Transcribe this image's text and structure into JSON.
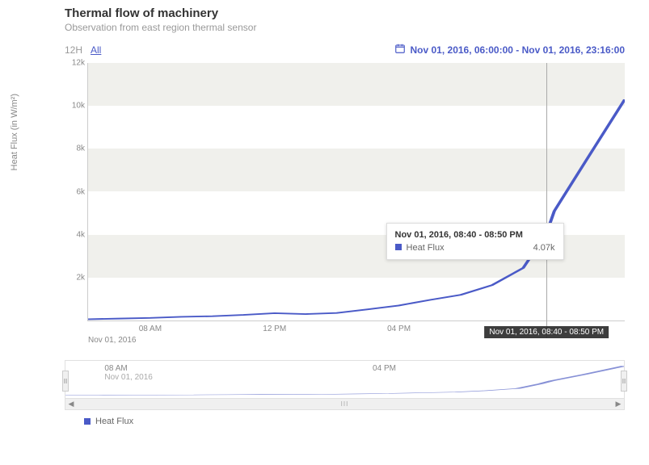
{
  "title": "Thermal flow of machinery",
  "subtitle": "Observation from east region thermal sensor",
  "range_buttons": {
    "h12": "12H",
    "all": "All"
  },
  "date_range": "Nov 01, 2016, 06:00:00 - Nov 01, 2016, 23:16:00",
  "yaxis_label": "Heat Flux (in W/m²)",
  "y_ticks": [
    "2k",
    "4k",
    "6k",
    "8k",
    "10k",
    "12k"
  ],
  "x_ticks": [
    "08 AM",
    "12 PM",
    "04 PM"
  ],
  "x_subtitle": "Nov 01, 2016",
  "cursor": {
    "time_label": "Nov 01, 2016, 08:40 - 08:50 PM"
  },
  "tooltip": {
    "title": "Nov 01, 2016, 08:40 - 08:50 PM",
    "series": "Heat Flux",
    "value": "4.07k"
  },
  "nav": {
    "ticks": [
      "08 AM",
      "04 PM"
    ],
    "sub": "Nov 01, 2016"
  },
  "legend": {
    "series": "Heat Flux"
  },
  "colors": {
    "accent": "#4a5ac7"
  },
  "chart_data": {
    "type": "line",
    "title": "Thermal flow of machinery",
    "subtitle": "Observation from east region thermal sensor",
    "xlabel": "",
    "ylabel": "Heat Flux (in W/m²)",
    "xrange": [
      "2016-11-01T06:00:00",
      "2016-11-01T23:16:00"
    ],
    "ylim": [
      0,
      12000
    ],
    "series": [
      {
        "name": "Heat Flux",
        "color": "#4a5ac7",
        "x": [
          "06:00",
          "07:00",
          "08:00",
          "09:00",
          "10:00",
          "11:00",
          "12:00",
          "13:00",
          "14:00",
          "15:00",
          "16:00",
          "17:00",
          "18:00",
          "19:00",
          "20:00",
          "20:45",
          "21:00",
          "22:00",
          "23:16"
        ],
        "y": [
          60,
          90,
          120,
          170,
          200,
          260,
          340,
          300,
          350,
          520,
          700,
          960,
          1200,
          1650,
          2450,
          4070,
          5100,
          7400,
          10300
        ]
      }
    ],
    "highlight_point": {
      "x": "20:45",
      "y": 4070,
      "label": "Nov 01, 2016, 08:40 - 08:50 PM"
    }
  }
}
